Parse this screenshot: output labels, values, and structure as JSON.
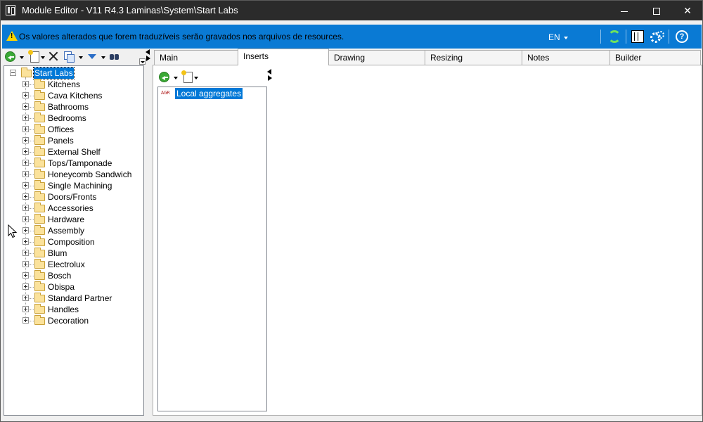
{
  "window": {
    "title": "Module Editor - V11 R4.3 Laminas\\System\\Start Labs",
    "controls": {
      "minimize": "minimize",
      "maximize": "maximize",
      "close": "✕"
    }
  },
  "infobar": {
    "message": "Os valores alterados que forem traduzíveis serão gravados nos arquivos de resources.",
    "language": "EN",
    "accent_color": "#0a7ad4",
    "icons": [
      "warning-icon",
      "refresh-icon",
      "layout-icon",
      "settings-icon",
      "help-icon"
    ],
    "help_glyph": "?"
  },
  "tree": {
    "root": "Start Labs",
    "items": [
      "Kitchens",
      "Cava Kitchens",
      "Bathrooms",
      "Bedrooms",
      "Offices",
      "Panels",
      "External Shelf",
      "Tops/Tamponade",
      "Honeycomb Sandwich",
      "Single Machining",
      "Doors/Fronts",
      "Accessories",
      "Hardware",
      "Assembly",
      "Composition",
      "Blum",
      "Electrolux",
      "Bosch",
      "Obispa",
      "Standard Partner",
      "Handles",
      "Decoration"
    ]
  },
  "tabs": [
    "Main",
    "Inserts",
    "Drawing",
    "Resizing",
    "Notes",
    "Builder"
  ],
  "active_tab": "Inserts",
  "inserts": {
    "items": [
      {
        "code": "AGR",
        "label": "Local aggregates",
        "selected": true
      }
    ]
  },
  "colors": {
    "titlebar": "#2b2b2b",
    "selection": "#0078d7",
    "warning": "#ffd500"
  }
}
